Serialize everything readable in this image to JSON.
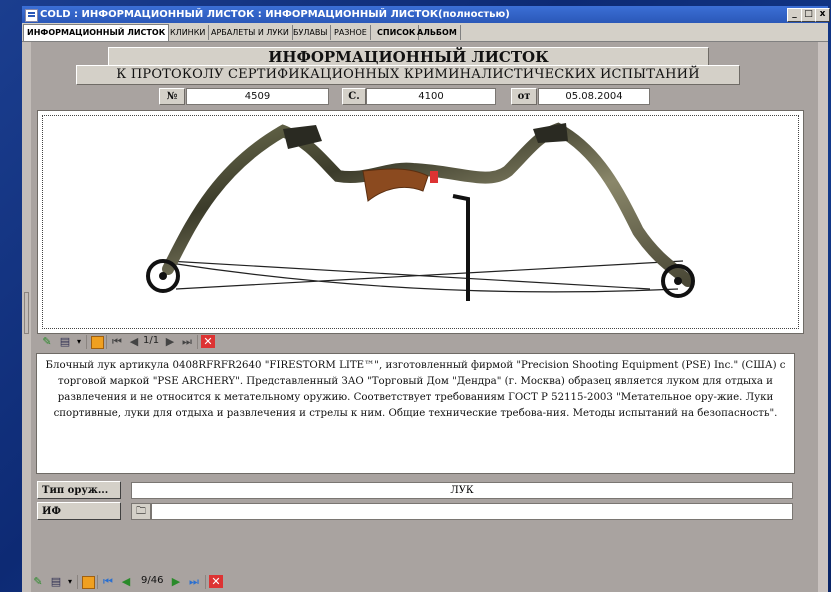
{
  "window": {
    "title": "COLD : ИНФОРМАЦИОННЫЙ ЛИСТОК : ИНФОРМАЦИОННЫЙ ЛИСТОК(полностью)",
    "controls": [
      "_",
      "□",
      "x"
    ]
  },
  "tabs": [
    {
      "label": "ИНФОРМАЦИОННЫЙ ЛИСТОК",
      "active": true
    },
    {
      "label": "КЛИНКИ",
      "active": false
    },
    {
      "label": "АРБАЛЕТЫ И ЛУКИ",
      "active": false
    },
    {
      "label": "БУЛАВЫ",
      "active": false
    },
    {
      "label": "РАЗНОЕ",
      "active": false
    },
    {
      "label": "СПИСОК",
      "active": false
    },
    {
      "label": "АЛЬБОМ",
      "active": false
    }
  ],
  "header": {
    "title": "ИНФОРМАЦИОННЫЙ ЛИСТОК",
    "subtitle": "К ПРОТОКОЛУ СЕРТИФИКАЦИОННЫХ КРИМИНАЛИСТИЧЕСКИХ ИСПЫТАНИЙ"
  },
  "meta": {
    "num_label": "№",
    "num_value": "4509",
    "c_label": "С.",
    "c_value": "4100",
    "date_label": "от",
    "date_value": "05.08.2004"
  },
  "image_nav": {
    "counter": "1/1"
  },
  "description": "Блочный лук артикула 0408RFRFR2640 \"FIRESTORM LITE™\", изготовленный фирмой \"Precision Shooting Equipment (PSE) Inc.\" (США) с торговой маркой \"PSE ARCHERY\". Представленный ЗАО \"Торговый Дом \"Дендра\" (г. Москва) образец является луком для отдыха и развлечения и не относится к метательному оружию. Соответствует требованиям ГОСТ Р 52115-2003 \"Метательное ору-жие. Луки спортивные, луки для отдыха и развлечения и стрелы к ним. Общие технические требова-ния. Методы испытаний на безопасность\".",
  "fields": {
    "type_button": "Тип оруж...",
    "type_value": "ЛУК",
    "if_label": "ИФ",
    "if_value": ""
  },
  "record_nav": {
    "counter": "9/46"
  },
  "colors": {
    "title_bar": "#2b58b8",
    "form_bg": "#a9a3a0",
    "close_red": "#d33"
  }
}
